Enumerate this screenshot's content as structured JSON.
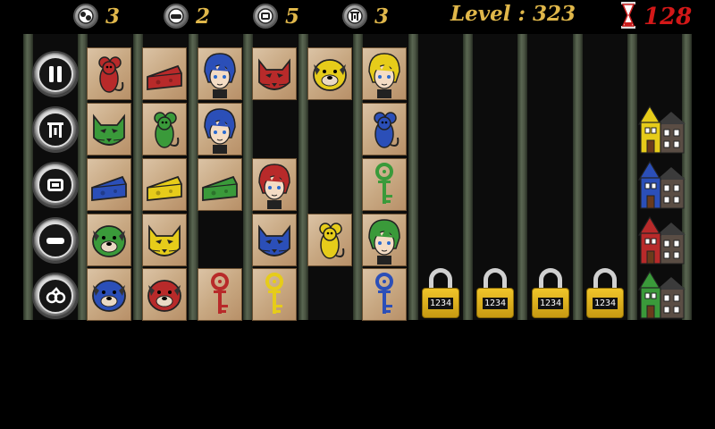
{
  "hud": {
    "counters": [
      {
        "icon": "cog-icon",
        "value": "3"
      },
      {
        "icon": "cheese-slice-icon",
        "value": "2"
      },
      {
        "icon": "sandwich-icon",
        "value": "5"
      },
      {
        "icon": "trap-icon",
        "value": "3"
      }
    ],
    "level": "Level : 323",
    "timer": "128"
  },
  "side_buttons": [
    {
      "name": "pause-button",
      "icon": "pause-icon"
    },
    {
      "name": "trap-powerup-button",
      "icon": "trap-icon"
    },
    {
      "name": "sandwich-powerup-button",
      "icon": "sandwich-icon"
    },
    {
      "name": "cheese-powerup-button",
      "icon": "cheese-slice-icon"
    },
    {
      "name": "cog-powerup-button",
      "icon": "cog-icon"
    }
  ],
  "board": {
    "columns": [
      [
        "mouse-red",
        "cat-green",
        "cheese-blue",
        "bulldog-green",
        "bulldog-blue"
      ],
      [
        "cheese-red",
        "mouse-green",
        "cheese-yellow",
        "cat-yellow",
        "bulldog-red"
      ],
      [
        "boy-blue",
        "boy-blue",
        "cheese-green",
        "",
        "key-red"
      ],
      [
        "cat-red",
        "",
        "girl-red",
        "cat-blue",
        "key-yellow"
      ],
      [
        "bulldog-yellow",
        "",
        "",
        "mouse-yellow",
        ""
      ],
      [
        "boy-yellow",
        "mouse-blue",
        "key-green",
        "boy-green",
        "key-blue"
      ]
    ],
    "locks": [
      "1234",
      "1234",
      "1234",
      "1234"
    ],
    "houses": [
      "house-yellow",
      "house-blue",
      "house-red",
      "house-green"
    ]
  },
  "colors": {
    "red": "#b82a2a",
    "green": "#3a9a3a",
    "blue": "#2b4fb8",
    "yellow": "#e6cc1a",
    "hud_gold": "#e0b74a",
    "timer_red": "#d31818"
  }
}
